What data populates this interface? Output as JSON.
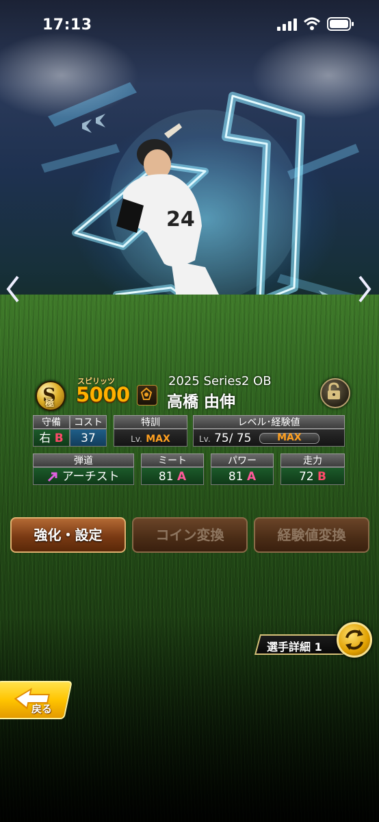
{
  "status_bar": {
    "time": "17:13"
  },
  "card": {
    "rank_letter": "S",
    "rank_sub": "極",
    "spirits_label": "スピリッツ",
    "spirits_value": "5000",
    "series": "2025 Series2 OB",
    "player_name": "高橋 由伸"
  },
  "stats": {
    "fielding": {
      "header": "守備",
      "value": "右",
      "grade": "B"
    },
    "cost": {
      "header": "コスト",
      "value": "37"
    },
    "training": {
      "header": "特訓",
      "lv_prefix": "Lv.",
      "value": "MAX"
    },
    "level": {
      "header": "レベル･経験値",
      "lv_prefix": "Lv.",
      "value": "75/ 75",
      "exp_label": "MAX"
    },
    "trajectory": {
      "header": "弾道",
      "value": "アーチスト"
    },
    "meet": {
      "header": "ミート",
      "value": "81",
      "grade": "A"
    },
    "power": {
      "header": "パワー",
      "value": "81",
      "grade": "A"
    },
    "speed": {
      "header": "走力",
      "value": "72",
      "grade": "B"
    }
  },
  "buttons": {
    "upgrade": "強化・設定",
    "coin_exchange": "コイン変換",
    "exp_exchange": "経験値変換"
  },
  "detail_tab": "選手詳細 1",
  "back": "戻る",
  "icons": [
    "chevron-left-icon",
    "chevron-right-icon",
    "lock-icon",
    "switch-icon",
    "back-arrow-icon",
    "signal-icon",
    "wifi-icon",
    "battery-icon",
    "team-logo-icon",
    "trajectory-arrow-icon"
  ],
  "colors": {
    "accent_gold": "#ffb000",
    "grade_red": "#ff4a6a",
    "max_orange": "#ffa020",
    "button_brown": "#7a3a14",
    "back_yellow": "#ffc400"
  }
}
